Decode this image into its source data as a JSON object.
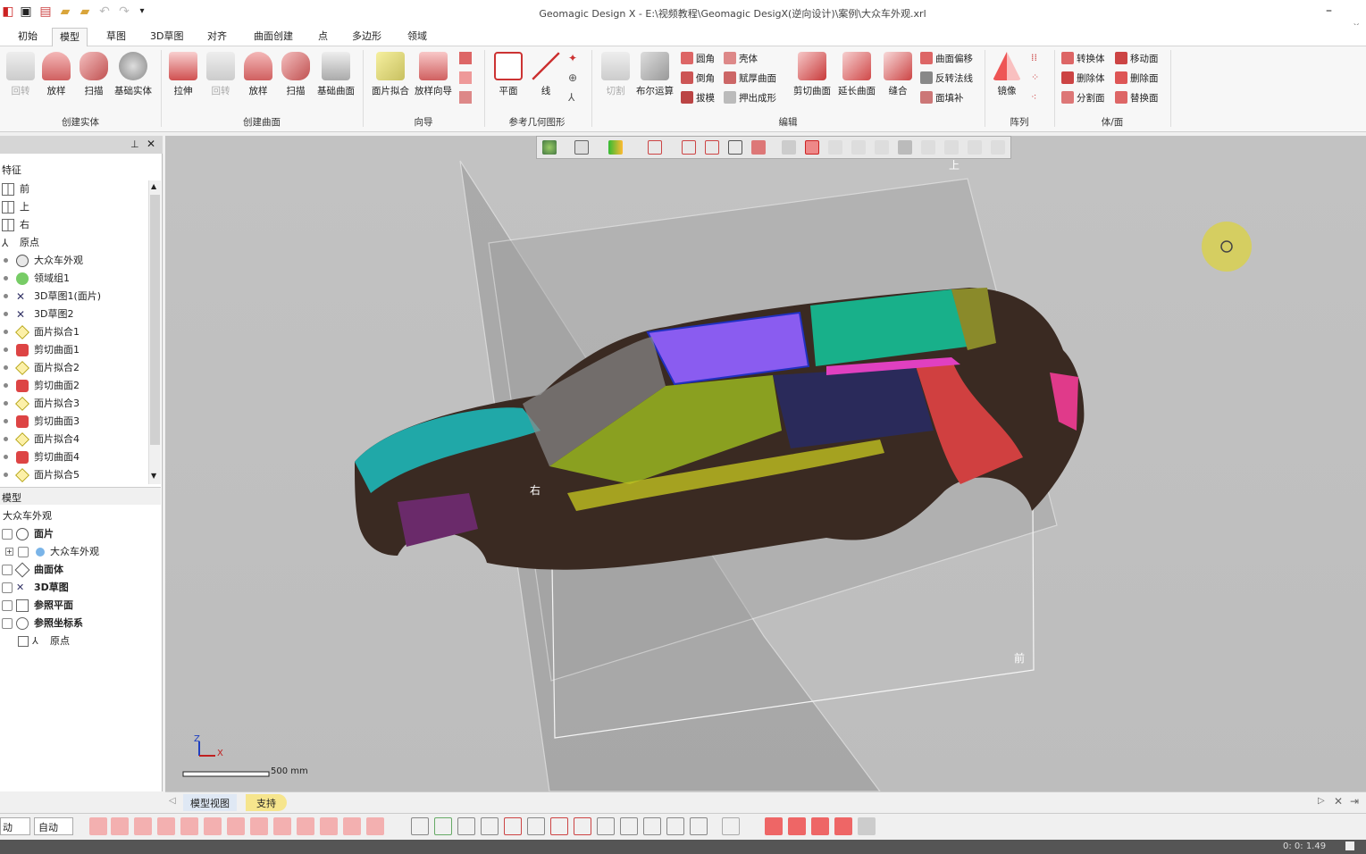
{
  "window": {
    "title": "Geomagic Design X - E:\\视频教程\\Geomagic DesigX(逆向设计)\\案例\\大众车外观.xrl"
  },
  "tabs": [
    "初始",
    "模型",
    "草图",
    "3D草图",
    "对齐",
    "曲面创建",
    "点",
    "多边形",
    "领域"
  ],
  "ribbon": {
    "solid": {
      "revolve": "回转",
      "loft": "放样",
      "sweep": "扫描",
      "base": "基础实体",
      "group": "创建实体"
    },
    "surface": {
      "extrude": "拉伸",
      "revolve": "回转",
      "loft": "放样",
      "sweep": "扫描",
      "base": "基础曲面",
      "group": "创建曲面"
    },
    "wizard": {
      "patchfit": "面片拟合",
      "loftwizard": "放样向导",
      "group": "向导"
    },
    "refgeo": {
      "plane": "平面",
      "line": "线",
      "group": "参考几何图形"
    },
    "edit": {
      "cut": "切割",
      "boolean": "布尔运算",
      "fillet": "圆角",
      "chamfer": "倒角",
      "draft": "拔模",
      "shell": "壳体",
      "thicken": "赋厚曲面",
      "extrudeform": "押出成形",
      "trim": "剪切曲面",
      "extend": "延长曲面",
      "stitch": "缝合",
      "offset": "曲面偏移",
      "reversenormal": "反转法线",
      "fillface": "面填补",
      "group": "编辑"
    },
    "pattern": {
      "mirror": "镜像",
      "group": "阵列"
    },
    "bodyface": {
      "convert": "转换体",
      "delete": "删除体",
      "split": "分割面",
      "move": "移动面",
      "delface": "删除面",
      "replace": "替换面",
      "group": "体/面"
    }
  },
  "features": {
    "header": "特征",
    "items": [
      "前",
      "上",
      "右",
      "原点",
      "大众车外观",
      "领域组1",
      "3D草图1(面片)",
      "3D草图2",
      "面片拟合1",
      "剪切曲面1",
      "面片拟合2",
      "剪切曲面2",
      "面片拟合3",
      "剪切曲面3",
      "面片拟合4",
      "剪切曲面4",
      "面片拟合5"
    ]
  },
  "model": {
    "header": "模型",
    "root": "大众车外观",
    "items": [
      "面片",
      "大众车外观",
      "曲面体",
      "3D草图",
      "参照平面",
      "参照坐标系",
      "原点"
    ]
  },
  "viewport": {
    "plane_labels": {
      "top": "上",
      "right": "右",
      "front": "前"
    },
    "scale": "500 mm",
    "axes": {
      "z": "Z",
      "x": "X"
    }
  },
  "bottom_tabs": [
    "模型视图",
    "支持"
  ],
  "bottombar": {
    "mode1": "动",
    "mode2": "自动"
  },
  "status": {
    "time": "0: 0: 1.49"
  },
  "colors": {
    "accent": "#c03030",
    "active_tab": "#f6e58d",
    "cursor": "#d4cf4a"
  }
}
